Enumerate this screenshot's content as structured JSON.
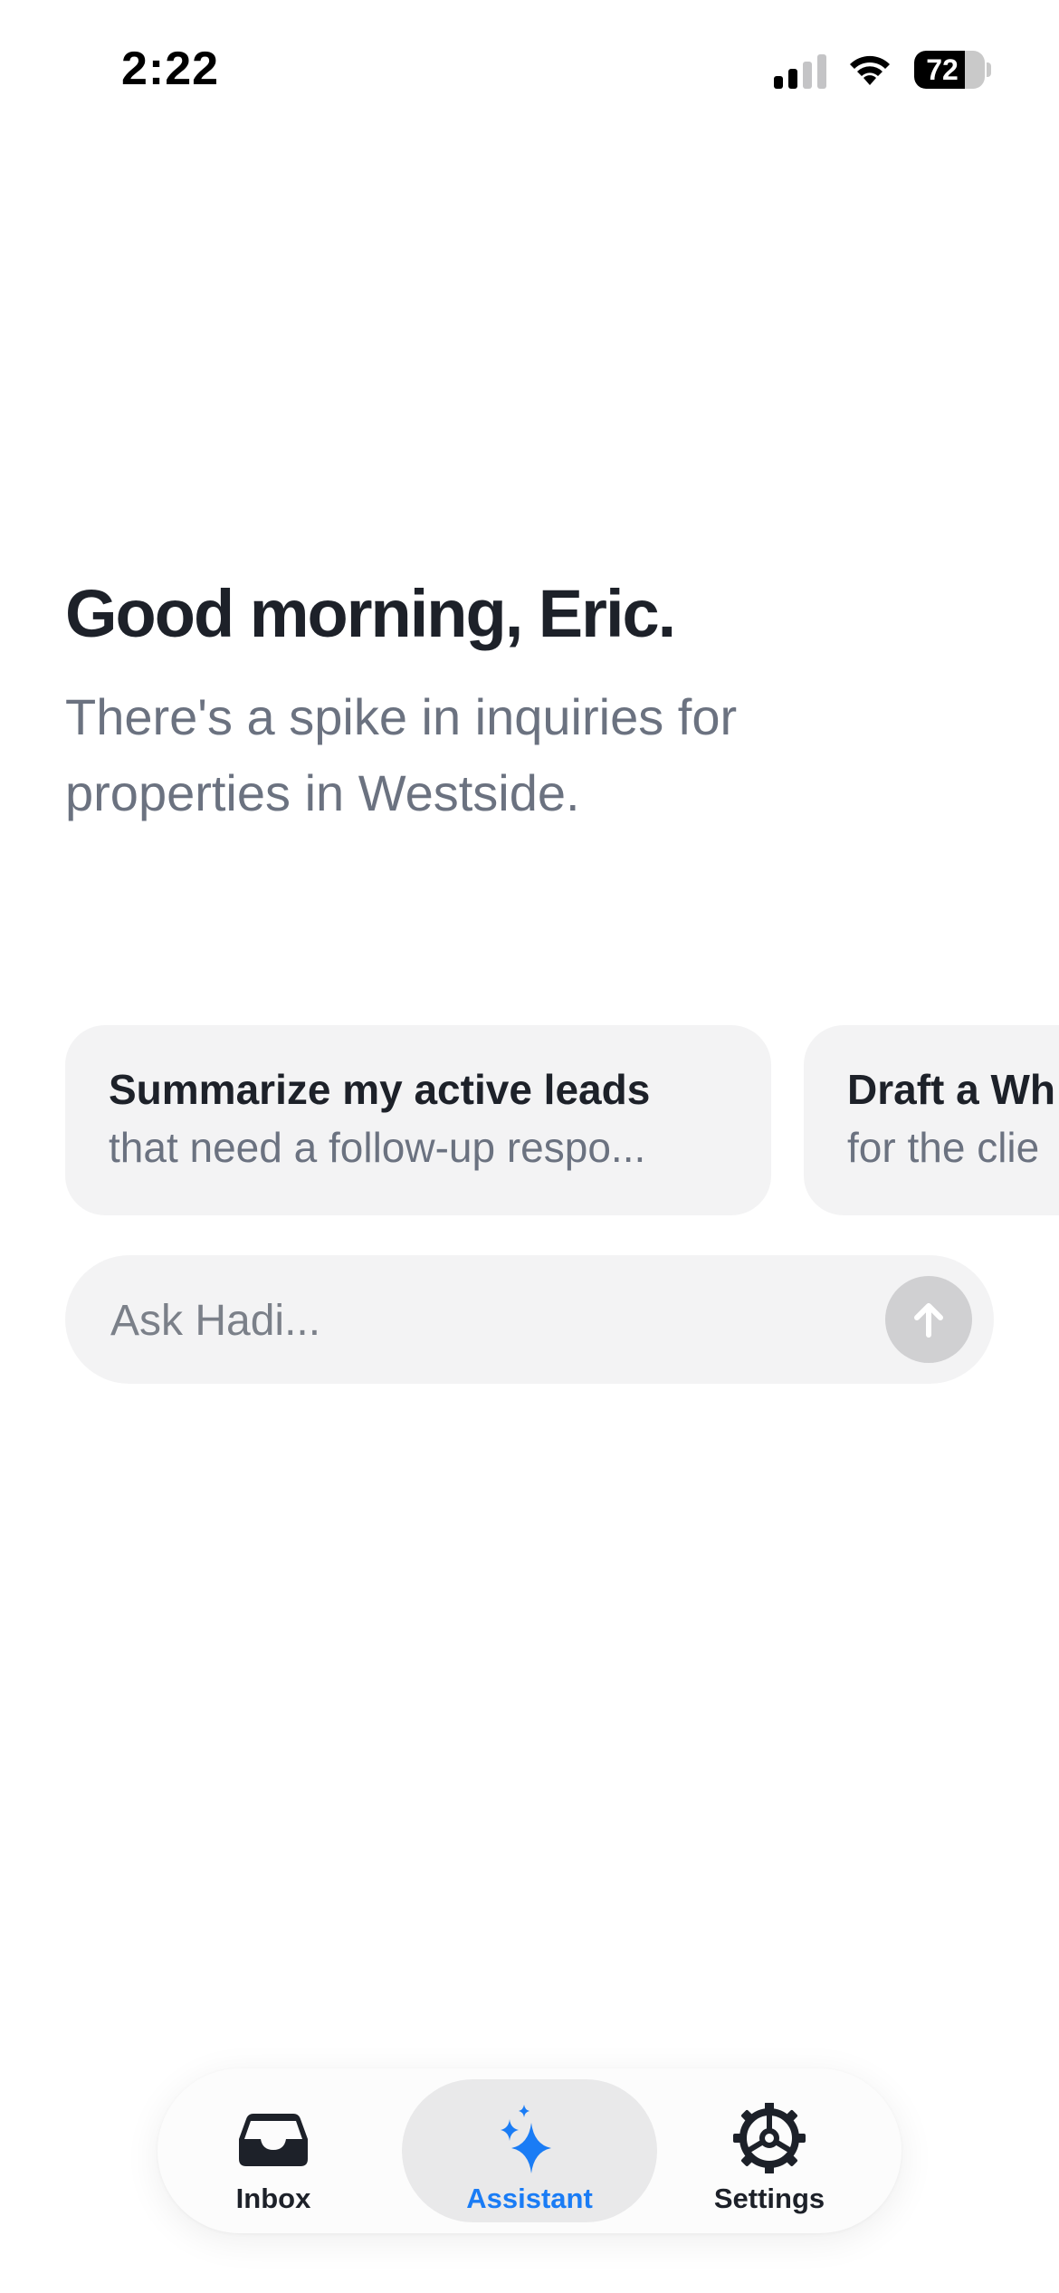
{
  "status_bar": {
    "time": "2:22",
    "battery_percent": "72",
    "battery_level": 0.72,
    "signal_bars_active": 2,
    "signal_bars_total": 4
  },
  "greeting": {
    "title": "Good morning, Eric.",
    "subtitle": "There's a spike in inquiries for properties in Westside."
  },
  "suggestions": [
    {
      "title": "Summarize my active leads",
      "subtitle": "that need a follow-up respo..."
    },
    {
      "title": "Draft a Wh",
      "subtitle": "for the clie"
    }
  ],
  "ask": {
    "placeholder": "Ask Hadi...",
    "value": "",
    "send_icon": "arrow-up-icon"
  },
  "tabs": [
    {
      "label": "Inbox",
      "icon": "inbox-icon",
      "active": false
    },
    {
      "label": "Assistant",
      "icon": "sparkle-icon",
      "active": true
    },
    {
      "label": "Settings",
      "icon": "gear-icon",
      "active": false
    }
  ],
  "colors": {
    "accent": "#1a7cf5",
    "text_primary": "#1d2129",
    "text_secondary": "#6b7280",
    "card_bg": "#f3f3f4",
    "active_tab_bg": "#e9e9ea"
  }
}
